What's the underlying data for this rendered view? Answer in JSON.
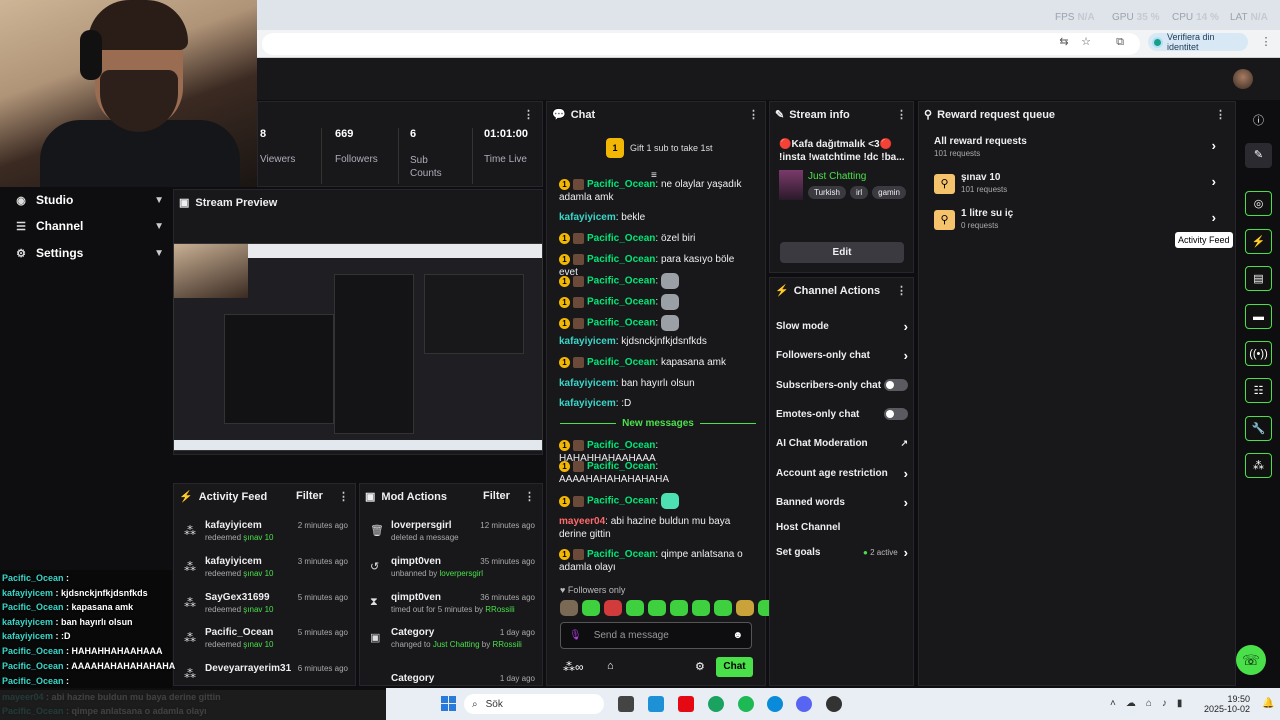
{
  "browser": {
    "stats": [
      {
        "label": "FPS",
        "value": "N/A"
      },
      {
        "label": "GPU",
        "value": "35 %"
      },
      {
        "label": "CPU",
        "value": "14 %"
      },
      {
        "label": "LAT",
        "value": "N/A"
      }
    ],
    "verify_label": "Verifiera din identitet"
  },
  "nav": {
    "items": [
      {
        "label": "Studio"
      },
      {
        "label": "Channel"
      },
      {
        "label": "Settings"
      }
    ]
  },
  "stats_panel": {
    "cells": [
      {
        "value": "8",
        "label": "Viewers"
      },
      {
        "value": "669",
        "label": "Followers"
      },
      {
        "value": "6",
        "label": "Sub Counts"
      },
      {
        "value": "01:01:00",
        "label": "Time Live"
      }
    ]
  },
  "preview": {
    "title": "Stream Preview"
  },
  "chat": {
    "title": "Chat",
    "gift_text": "Gift 1 sub to take 1st",
    "new_messages_label": "New messages",
    "followers_only": "Followers only",
    "input_placeholder": "Send a message",
    "send_label": "Chat",
    "messages": [
      {
        "user": "Pacific_Ocean",
        "text": "ne olaylar yaşadık adamla amk",
        "style": "green",
        "badges": true
      },
      {
        "user": "kafayiyicem",
        "text": "bekle",
        "style": "teal",
        "badges": false
      },
      {
        "user": "Pacific_Ocean",
        "text": "özel biri",
        "style": "green",
        "badges": true
      },
      {
        "user": "Pacific_Ocean",
        "text": "para kasıyo böle evet",
        "style": "green",
        "badges": true
      },
      {
        "user": "Pacific_Ocean",
        "text": "",
        "style": "green",
        "badges": true,
        "emote": true
      },
      {
        "user": "Pacific_Ocean",
        "text": "",
        "style": "green",
        "badges": true,
        "emote": true
      },
      {
        "user": "Pacific_Ocean",
        "text": "",
        "style": "green",
        "badges": true,
        "emote": true
      },
      {
        "user": "kafayiyicem",
        "text": "kjdsnckjnfkjdsnfkds",
        "style": "teal",
        "badges": false
      },
      {
        "user": "Pacific_Ocean",
        "text": "kapasana amk",
        "style": "green",
        "badges": true
      },
      {
        "user": "kafayiyicem",
        "text": "ban hayırlı olsun",
        "style": "teal",
        "badges": false
      },
      {
        "user": "kafayiyicem",
        "text": ":D",
        "style": "teal",
        "badges": false
      }
    ],
    "new_messages": [
      {
        "user": "Pacific_Ocean",
        "text": "HAHAHHAHAAHAAA",
        "style": "green",
        "badges": true
      },
      {
        "user": "Pacific_Ocean",
        "text": "AAAAHAHAHAHAHAHA",
        "style": "green",
        "badges": true
      },
      {
        "user": "Pacific_Ocean",
        "text": "",
        "style": "green",
        "badges": true,
        "emote": true
      },
      {
        "user": "mayeer04",
        "text": "abi hazine buldun mu baya derine gittin",
        "style": "red",
        "badges": false
      },
      {
        "user": "Pacific_Ocean",
        "text": "qimpe anlatsana o adamla olayı",
        "style": "green",
        "badges": true
      }
    ]
  },
  "stream_info": {
    "title": "Stream info",
    "stream_title": "🔴Kafa dağıtmalık <3🔴 !insta !watchtime !dc !ba...",
    "category": "Just Chatting",
    "tags": [
      "Turkish",
      "irl",
      "gamin"
    ],
    "edit_label": "Edit"
  },
  "channel_actions": {
    "title": "Channel Actions",
    "items": [
      {
        "label": "Slow mode",
        "control": "chevron"
      },
      {
        "label": "Followers-only chat",
        "control": "chevron"
      },
      {
        "label": "Subscribers-only chat",
        "control": "toggle"
      },
      {
        "label": "Emotes-only chat",
        "control": "toggle"
      },
      {
        "label": "AI Chat Moderation",
        "control": "external"
      },
      {
        "label": "Account age restriction",
        "control": "chevron"
      },
      {
        "label": "Banned words",
        "control": "chevron"
      },
      {
        "label": "Host Channel",
        "control": "none"
      },
      {
        "label": "Set goals",
        "control": "chevron",
        "badge": "2 active"
      }
    ]
  },
  "rewards": {
    "title": "Reward request queue",
    "all_label": "All reward requests",
    "all_count": "101 requests",
    "items": [
      {
        "name": "şınav 10",
        "count": "101 requests"
      },
      {
        "name": "1 litre su iç",
        "count": "0 requests"
      }
    ]
  },
  "rail": {
    "tooltip": "Activity Feed"
  },
  "activity_feed": {
    "title": "Activity Feed",
    "filter_label": "Filter",
    "items": [
      {
        "user": "kafayiyicem",
        "time": "2 minutes ago",
        "action": "redeemed",
        "reward": "şınav 10"
      },
      {
        "user": "kafayiyicem",
        "time": "3 minutes ago",
        "action": "redeemed",
        "reward": "şınav 10"
      },
      {
        "user": "SayGex31699",
        "time": "5 minutes ago",
        "action": "redeemed",
        "reward": "şınav 10"
      },
      {
        "user": "Pacific_Ocean",
        "time": "5 minutes ago",
        "action": "redeemed",
        "reward": "şınav 10"
      },
      {
        "user": "Deveyarrayerim31",
        "time": "6 minutes ago",
        "action": "",
        "reward": ""
      }
    ]
  },
  "mod_actions": {
    "title": "Mod Actions",
    "filter_label": "Filter",
    "items": [
      {
        "user": "loverpersgirl",
        "time": "12 minutes ago",
        "desc": "deleted a message",
        "extra": ""
      },
      {
        "user": "qimpt0ven",
        "time": "35 minutes ago",
        "desc": "unbanned by",
        "extra": "loverpersgirl"
      },
      {
        "user": "qimpt0ven",
        "time": "36 minutes ago",
        "desc": "timed out for 5 minutes by",
        "extra": "RRossili"
      },
      {
        "user": "Category",
        "time": "1 day ago",
        "desc": "changed to",
        "extra": "Just Chatting",
        "by": "RRossili"
      },
      {
        "user": "Category",
        "time": "1 day ago",
        "desc": "",
        "extra": ""
      }
    ]
  },
  "overlay_chat": [
    {
      "user": "Pacific_Ocean",
      "text": ""
    },
    {
      "user": "kafayiyicem",
      "text": "kjdsnckjnfkjdsnfkds"
    },
    {
      "user": "Pacific_Ocean",
      "text": "kapasana amk"
    },
    {
      "user": "kafayiyicem",
      "text": "ban hayırlı olsun"
    },
    {
      "user": "kafayiyicem",
      "text": ":D"
    },
    {
      "user": "Pacific_Ocean",
      "text": "HAHAHHAHAAHAAA"
    },
    {
      "user": "Pacific_Ocean",
      "text": "AAAAHAHAHAHAHAHA"
    },
    {
      "user": "Pacific_Ocean",
      "text": ""
    },
    {
      "user": "mayeer04",
      "text": "abi hazine buldun mu baya derine gittin"
    },
    {
      "user": "Pacific_Ocean",
      "text": "qimpe anlatsana o adamla olayı"
    }
  ],
  "taskbar": {
    "search_label": "Sök",
    "time": "19:50",
    "date": "2025-10-02"
  }
}
